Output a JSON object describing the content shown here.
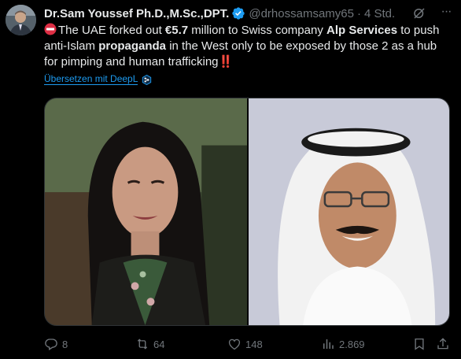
{
  "tweet": {
    "author_name": "Dr.Sam Youssef Ph.D.,M.Sc.,DPT.",
    "handle": "@drhossamsamy65",
    "separator": "·",
    "time": "4 Std.",
    "text_parts": {
      "p1": "The UAE forked out ",
      "p2": "€5.7",
      "p3": " million to Swiss company ",
      "p4": "Alp Services",
      "p5": " to push anti-Islam ",
      "p6": "propaganda",
      "p7": " in the West only to be exposed by those 2 as a hub for pimping and human trafficking",
      "p8": "‼️"
    },
    "translate_label": "Übersetzen mit DeepL",
    "more_label": "···"
  },
  "actions": {
    "replies": "8",
    "reposts": "64",
    "likes": "148",
    "views": "2.869"
  },
  "colors": {
    "background": "#000000",
    "text": "#e7e9ea",
    "muted": "#71767b",
    "accent": "#1d9bf0",
    "red": "#f4212e"
  },
  "icons": [
    "verified-badge-icon",
    "grok-icon",
    "more-icon",
    "no-entry-icon",
    "deepl-icon",
    "reply-icon",
    "repost-icon",
    "like-icon",
    "views-icon",
    "bookmark-icon",
    "share-icon"
  ]
}
